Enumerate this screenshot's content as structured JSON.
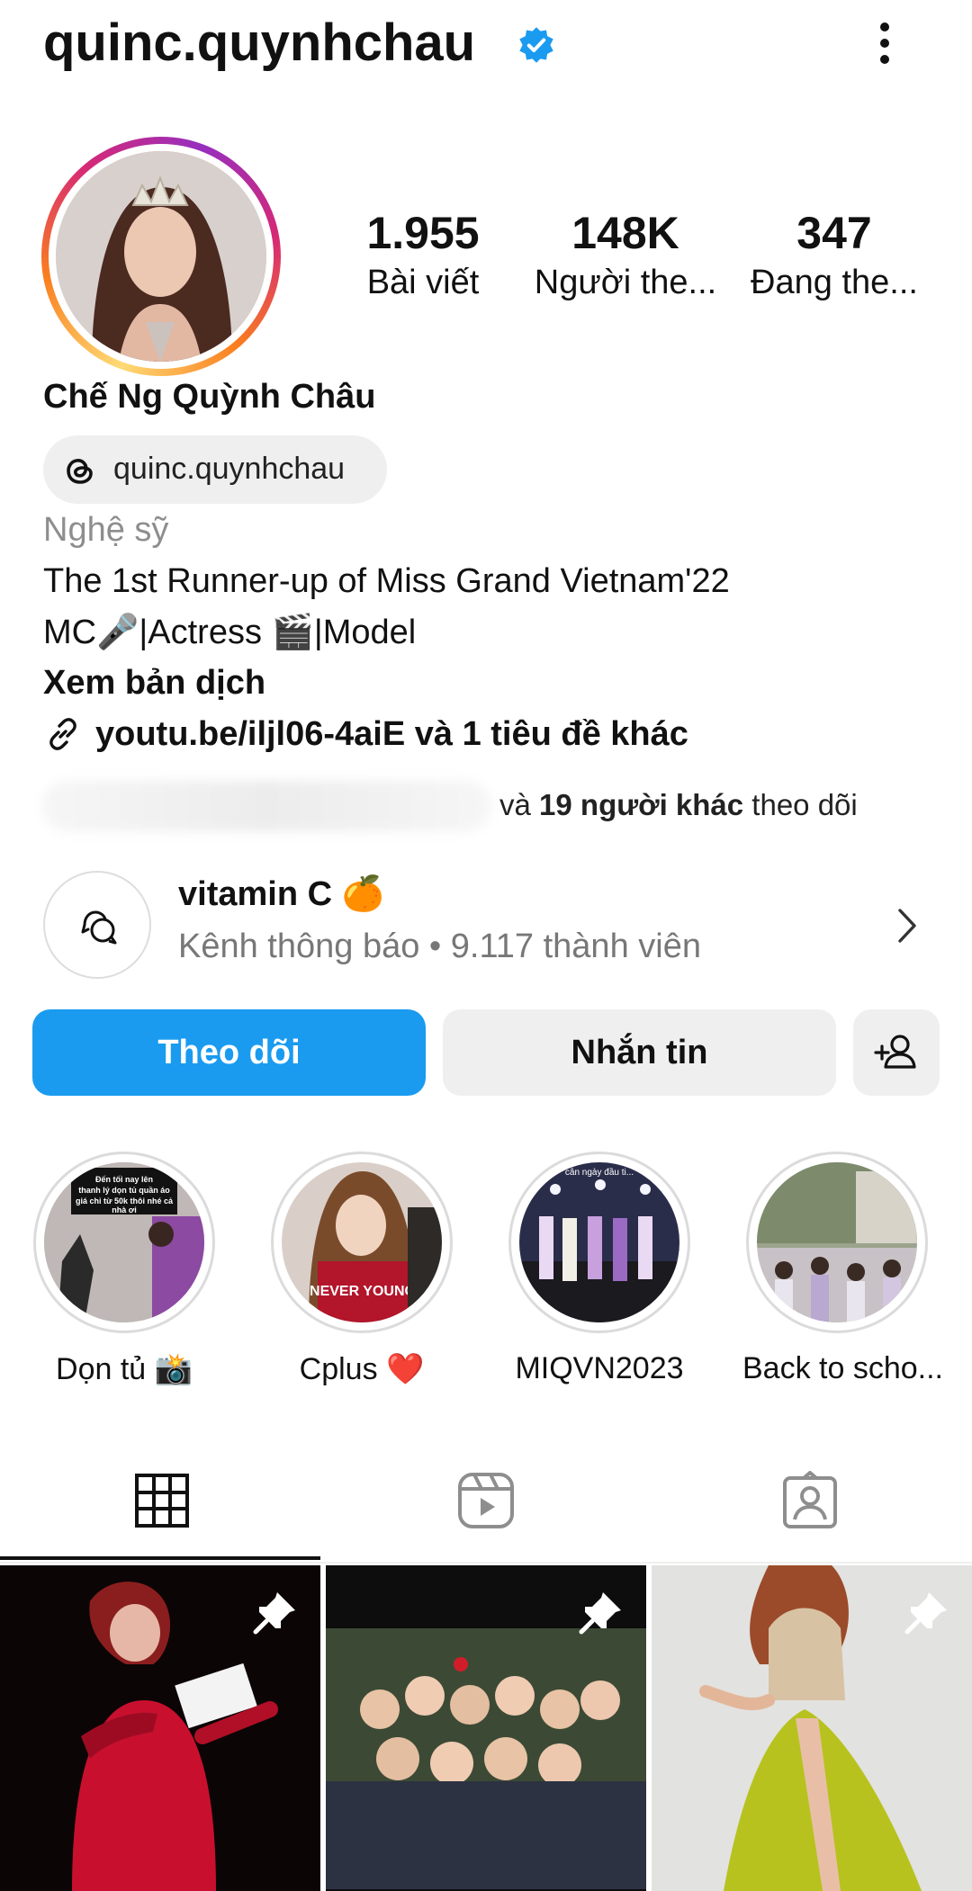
{
  "header": {
    "username": "quinc.quynhchau"
  },
  "stats": [
    {
      "value": "1.955",
      "label": "Bài viết"
    },
    {
      "value": "148K",
      "label": "Người the..."
    },
    {
      "value": "347",
      "label": "Đang the..."
    }
  ],
  "profile": {
    "full_name": "Chế Ng Quỳnh Châu",
    "threads_handle": "quinc.quynhchau",
    "category": "Nghệ sỹ",
    "bio_line1": "The 1st Runner-up of Miss Grand Vietnam'22",
    "bio_line2": "MC🎤|Actress 🎬|Model",
    "translate": "Xem bản dịch",
    "link": "youtu.be/iljl06-4aiE và 1 tiêu đề khác",
    "followed_by_prefix": "và ",
    "followed_by_count": "19 người khác",
    "followed_by_suffix": " theo dõi"
  },
  "channel": {
    "name": "vitamin C 🍊",
    "subtitle": "Kênh thông báo • 9.117 thành viên"
  },
  "actions": {
    "follow": "Theo dõi",
    "message": "Nhắn tin"
  },
  "highlights": [
    {
      "label": "Dọn tủ 📸",
      "overlay": "Đến tối nay lên thanh lý dọn tủ quần áo giá chỉ từ 50k thôi nhé cả nhà ơi"
    },
    {
      "label": "Cplus ❤️",
      "overlay": "NEVER YOUNG"
    },
    {
      "label": "MIQVN2023",
      "overlay": "cân ngày đầu ti..."
    },
    {
      "label": "Back to scho...",
      "overlay": ""
    }
  ],
  "colors": {
    "accent": "#1a9bf0",
    "verified": "#1a9bf0"
  },
  "icons": {
    "verified": "verified-badge-icon",
    "more": "more-vertical-icon",
    "threads": "threads-icon",
    "link": "link-icon",
    "channel": "chat-bubbles-icon",
    "chevron": "chevron-right-icon",
    "add_user": "add-user-icon",
    "grid_tab": "grid-icon",
    "reels_tab": "reels-icon",
    "tagged_tab": "tagged-icon",
    "pin": "pin-icon"
  }
}
